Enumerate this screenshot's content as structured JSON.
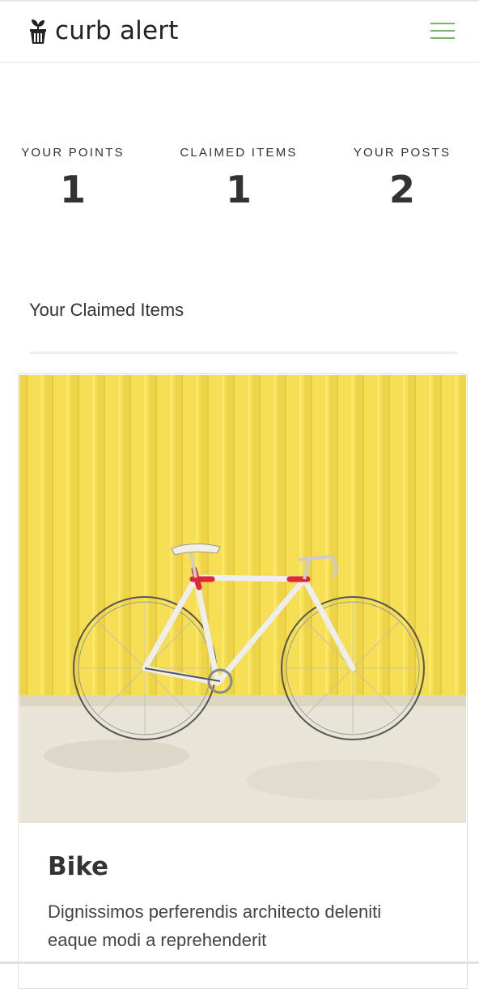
{
  "brand": {
    "name": "curb alert"
  },
  "stats": [
    {
      "label": "YOUR POINTS",
      "value": "1"
    },
    {
      "label": "CLAIMED ITEMS",
      "value": "1"
    },
    {
      "label": "YOUR POSTS",
      "value": "2"
    }
  ],
  "section": {
    "title": "Your Claimed Items"
  },
  "item": {
    "title": "Bike",
    "description": "Dignissimos perferendis architecto deleniti eaque modi a reprehenderit"
  },
  "colors": {
    "accent": "#7fb06d",
    "wall": "#f5dc52",
    "frame": "#e0263a"
  }
}
